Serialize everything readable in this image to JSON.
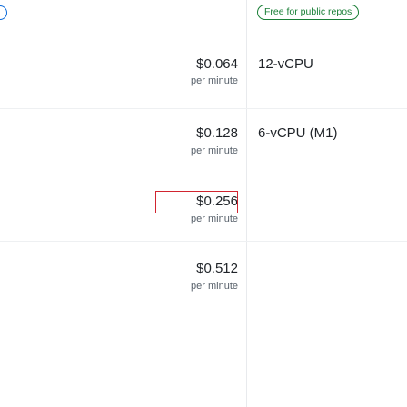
{
  "header": {
    "badge_label": "Free for public repos"
  },
  "rows": [
    {
      "price": "$0.064",
      "unit": "per minute",
      "spec": "12-vCPU"
    },
    {
      "price": "$0.128",
      "unit": "per minute",
      "spec": "6-vCPU (M1)"
    },
    {
      "price": "$0.256",
      "unit": "per minute",
      "spec": ""
    },
    {
      "price": "$0.512",
      "unit": "per minute",
      "spec": ""
    }
  ],
  "colors": {
    "badge": "#1a7f37",
    "highlight": "#d1242f",
    "accent": "#0969da"
  }
}
